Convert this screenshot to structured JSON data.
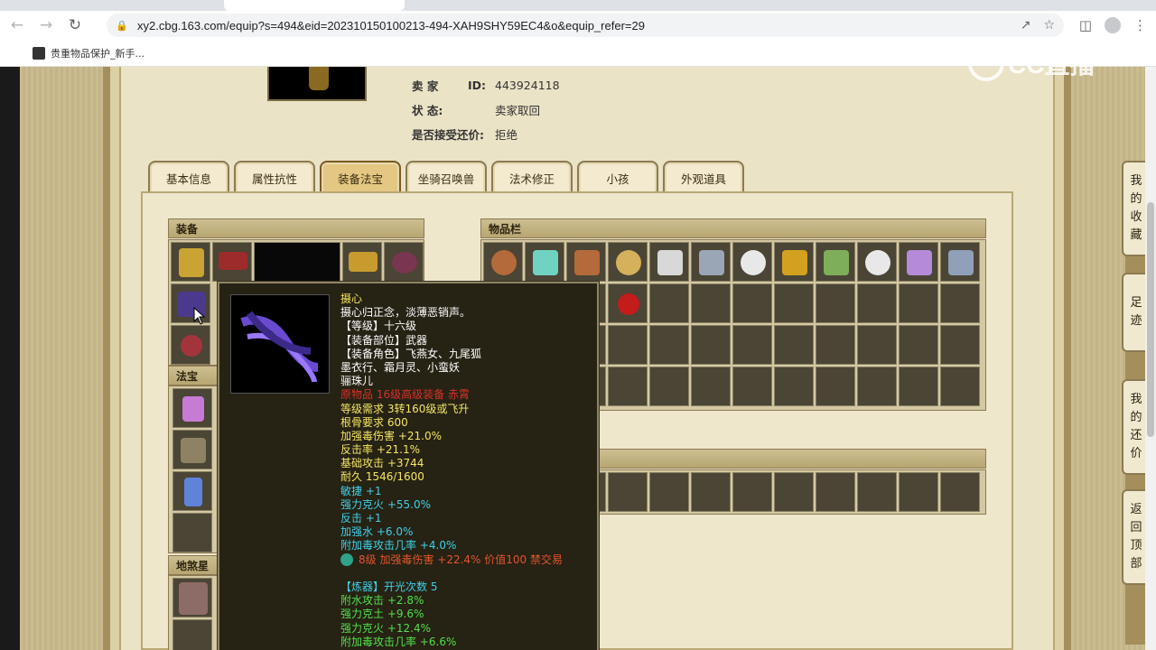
{
  "browser": {
    "url": "xy2.cbg.163.com/equip?s=494&eid=202310150100213-494-XAH9SHY59EC4&o&equip_refer=29",
    "bookmark_label": "贵重物品保护_新手..."
  },
  "seller": {
    "rows": [
      {
        "label": "卖    家",
        "value_label": "ID:",
        "value": "443924118"
      },
      {
        "label": "状      态:",
        "value": "卖家取回"
      },
      {
        "label": "是否接受还价:",
        "value": "拒绝"
      }
    ]
  },
  "tabs": [
    "基本信息",
    "属性抗性",
    "装备法宝",
    "坐骑召唤兽",
    "法术修正",
    "小孩",
    "外观道具"
  ],
  "active_tab": 2,
  "sections": {
    "equip": "装备",
    "fabao": "法宝",
    "disha": "地煞星",
    "inventory": "物品栏"
  },
  "tooltip": {
    "lines": [
      {
        "text": "摄心",
        "color": "#f5e663"
      },
      {
        "text": "摄心归正念，淡薄恶销声。",
        "color": "#ffffff"
      },
      {
        "text": "【等级】十六级",
        "color": "#ffffff"
      },
      {
        "text": "【装备部位】武器",
        "color": "#ffffff"
      },
      {
        "text": "【装备角色】飞燕女、九尾狐",
        "color": "#ffffff"
      },
      {
        "text": "墨衣行、霜月灵、小蛮妖",
        "color": "#ffffff"
      },
      {
        "text": "骊珠儿",
        "color": "#ffffff"
      },
      {
        "text": "原物品 16级高级装备 赤霄",
        "color": "#d9322a"
      },
      {
        "text": "等级需求 3转160级或飞升",
        "color": "#f5e663"
      },
      {
        "text": "根骨要求 600",
        "color": "#f5e663"
      },
      {
        "text": "加强毒伤害 +21.0%",
        "color": "#f5e663"
      },
      {
        "text": "反击率 +21.1%",
        "color": "#f5e663"
      },
      {
        "text": "基础攻击 +3744",
        "color": "#f5e663"
      },
      {
        "text": "耐久 1546/1600",
        "color": "#f5e663"
      },
      {
        "text": "敏捷 +1",
        "color": "#3fd1e8"
      },
      {
        "text": "强力克火 +55.0%",
        "color": "#3fd1e8"
      },
      {
        "text": "反击 +1",
        "color": "#3fd1e8"
      },
      {
        "text": "加强水 +6.0%",
        "color": "#3fd1e8"
      },
      {
        "text": "附加毒攻击几率 +4.0%",
        "color": "#3fd1e8"
      },
      {
        "text": "8级 加强毒伤害 +22.4% 价值100 禁交易",
        "color": "#e0562c",
        "gem": true
      },
      {
        "text": "",
        "color": "#ffffff"
      },
      {
        "text": "【炼器】开光次数 5",
        "color": "#3fd1e8"
      },
      {
        "text": "附水攻击 +2.8%",
        "color": "#52e04a"
      },
      {
        "text": "强力克土 +9.6%",
        "color": "#52e04a"
      },
      {
        "text": "强力克火 +12.4%",
        "color": "#52e04a"
      },
      {
        "text": "附加毒攻击几率 +6.6%",
        "color": "#52e04a"
      }
    ]
  },
  "side_buttons": [
    {
      "name": "favorites",
      "chars": [
        "我",
        "的",
        "收",
        "藏"
      ]
    },
    {
      "name": "footprint",
      "chars": [
        "足",
        "迹"
      ]
    },
    {
      "name": "my-offer",
      "chars": [
        "我",
        "的",
        "还",
        "价"
      ]
    },
    {
      "name": "back-top",
      "chars": [
        "返",
        "回",
        "顶",
        "部"
      ]
    }
  ],
  "watermark": "CC直播"
}
